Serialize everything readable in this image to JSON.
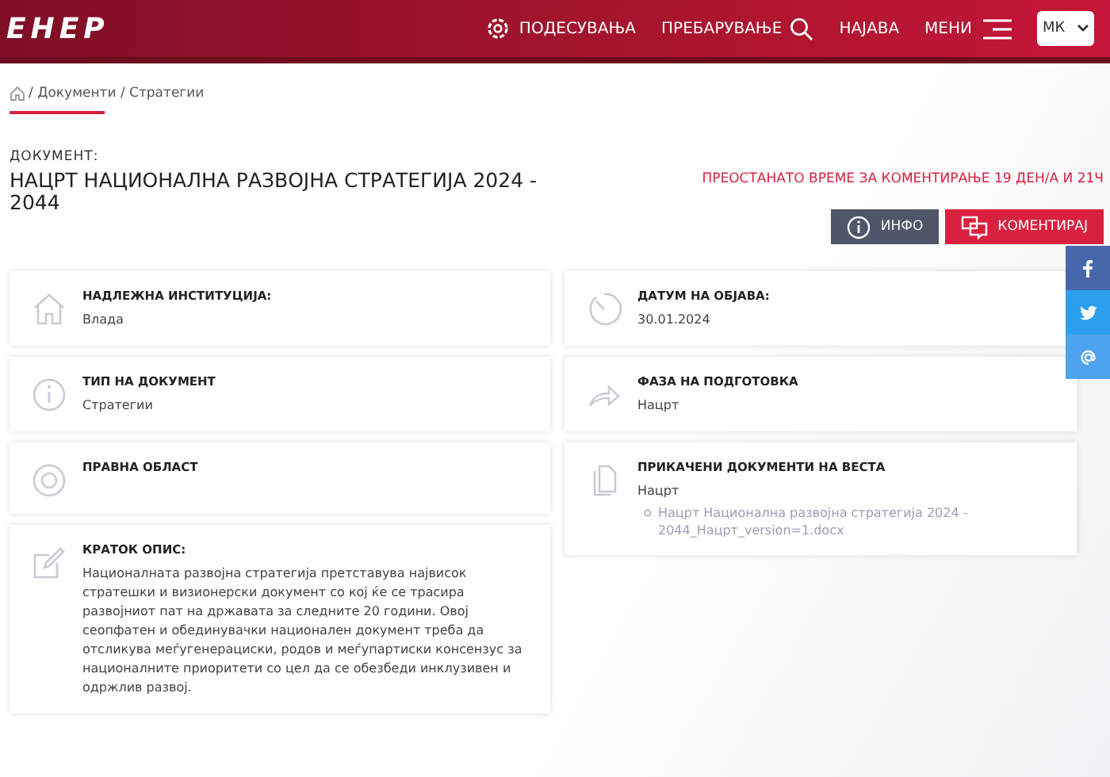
{
  "header": {
    "logo": "ЕНЕР",
    "nav": [
      {
        "label": "ПОДЕСУВАЊА",
        "kind": "settings"
      },
      {
        "label": "ПРЕБАРУВАЊЕ",
        "kind": "search"
      },
      {
        "label": "НАЈАВА",
        "kind": "plain"
      },
      {
        "label": "МЕНИ",
        "kind": "menu"
      }
    ],
    "language": "МК"
  },
  "breadcrumb": [
    "/ Документи / Стратегии"
  ],
  "document": {
    "label": "ДОКУМЕНТ:",
    "title": "НАЦРТ НАЦИОНАЛНА РАЗВОЈНА СТРАТЕГИЈА 2024 - 2044",
    "remaining": "ПРЕОСТАНАТО ВРЕМЕ ЗА КОМЕНТИРАЊЕ 19 ДЕН/А И 21Ч",
    "buttons": [
      {
        "label": "ИНФО",
        "kind": "info"
      },
      {
        "label": "КОМЕНТИРАЈ",
        "kind": "comment"
      }
    ]
  },
  "social": [
    {
      "kind": "facebook"
    },
    {
      "kind": "twitter"
    },
    {
      "kind": "email"
    }
  ],
  "left_cards": [
    {
      "kind": "house",
      "label": "НАДЛЕЖНА ИНСТИТУЦИЈА:",
      "value": "Влада"
    },
    {
      "kind": "info",
      "label": "ТИП НА ДОКУМЕНТ",
      "value": "Стратегии"
    },
    {
      "kind": "circle",
      "label": "ПРАВНА ОБЛАСТ"
    },
    {
      "kind": "edit",
      "label": "КРАТОК ОПИС:",
      "value": "Националната развојна стратегија претставува највисок стратешки и визионерски документ со кој ќе се трасира развојниот пат на државата за следните 20 години. Овој сеопфатен и обединувачки национален документ треба да отсликува меѓугенерациски, родов и меѓупартиски консензус за националните приоритети со цел да се обезбеди инклузивен и одржлив развој."
    }
  ],
  "right_cards": [
    {
      "kind": "clock",
      "label": "ДАТУМ НА ОБЈАВА:",
      "value": "30.01.2024"
    },
    {
      "kind": "share",
      "label": "ФАЗА НА ПОДГОТОВКА",
      "value": "Нацрт"
    },
    {
      "kind": "files",
      "label": "ПРИКАЧЕНИ ДОКУМЕНТИ НА ВЕСТА",
      "value": "Нацрт",
      "links": [
        "Нацрт Национална развојна стратегија 2024 - 2044_Нацрт_version=1.docx"
      ]
    }
  ]
}
